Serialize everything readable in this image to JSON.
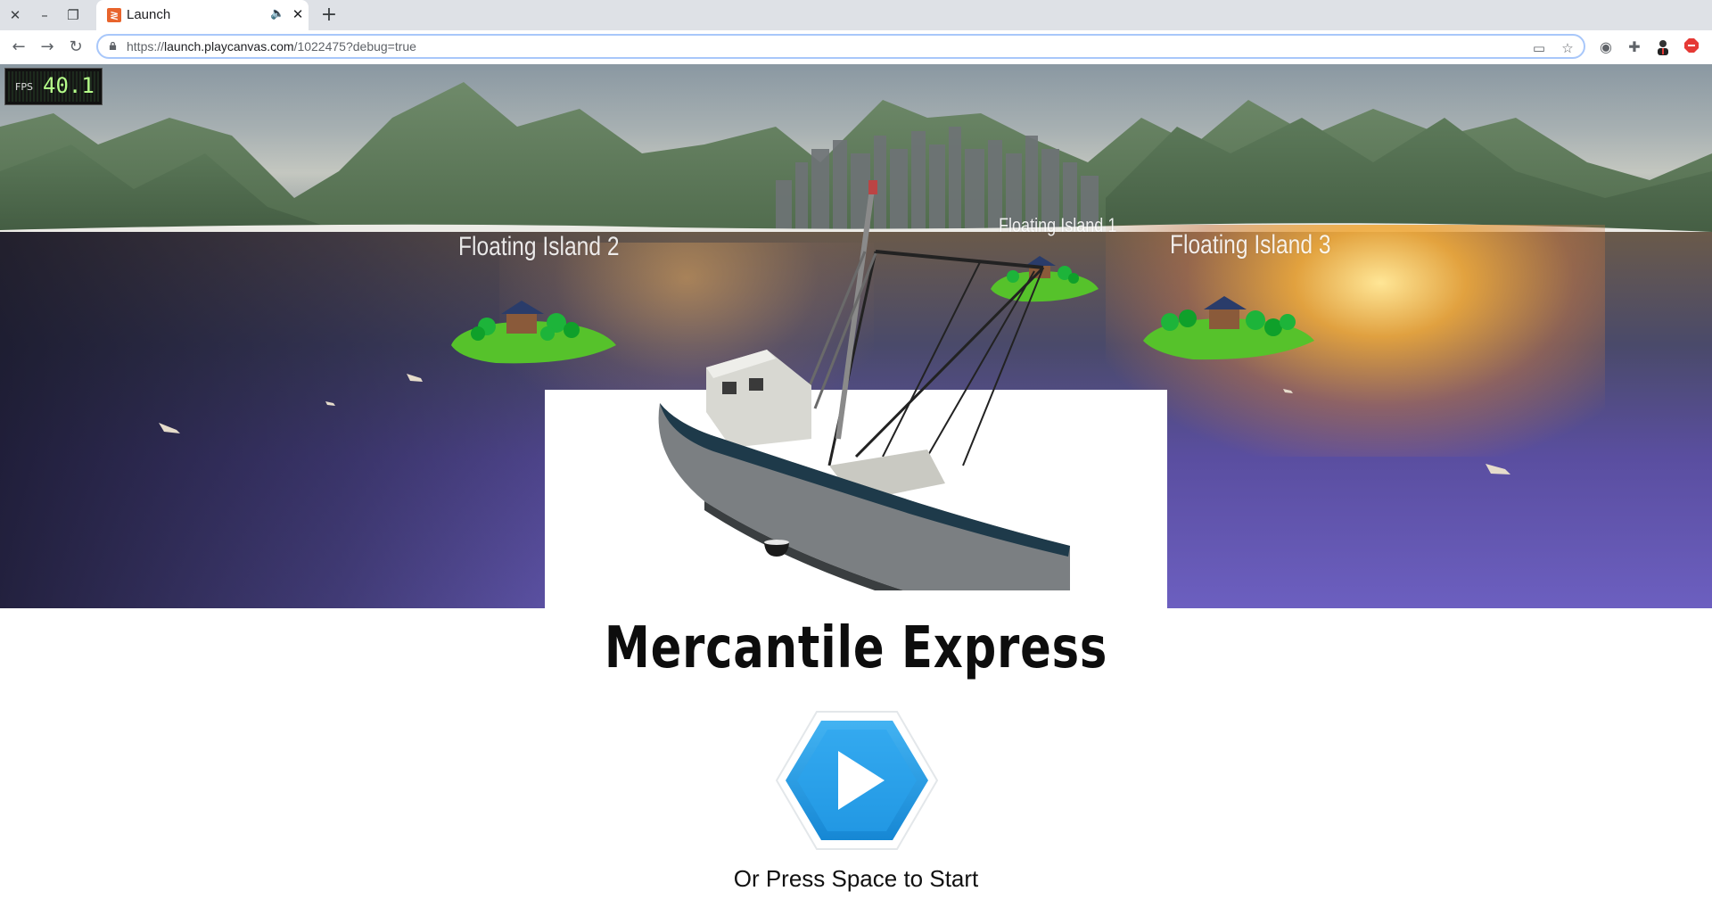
{
  "browser": {
    "tab_title": "Launch",
    "url_scheme": "https://",
    "url_host": "launch.playcanvas.com",
    "url_path": "/1022475?debug=true",
    "icons": [
      "close-icon",
      "minimize-icon",
      "restore-icon",
      "favicon-playcanvas-icon",
      "speaker-icon",
      "tab-close-icon",
      "new-tab-icon",
      "back-icon",
      "forward-icon",
      "reload-icon",
      "lock-icon",
      "cast-icon",
      "star-icon",
      "extension-icon",
      "puzzle-icon",
      "avatar",
      "adblock-icon"
    ]
  },
  "game": {
    "fps_label": "FPS",
    "fps_value": "40.1",
    "island_labels": [
      "Floating Island 2",
      "Floating Island 1",
      "Floating Island 3"
    ],
    "title": "Mercantile Express",
    "play_button_color": "#1e9be6",
    "hint": "Or Press Space to Start"
  }
}
